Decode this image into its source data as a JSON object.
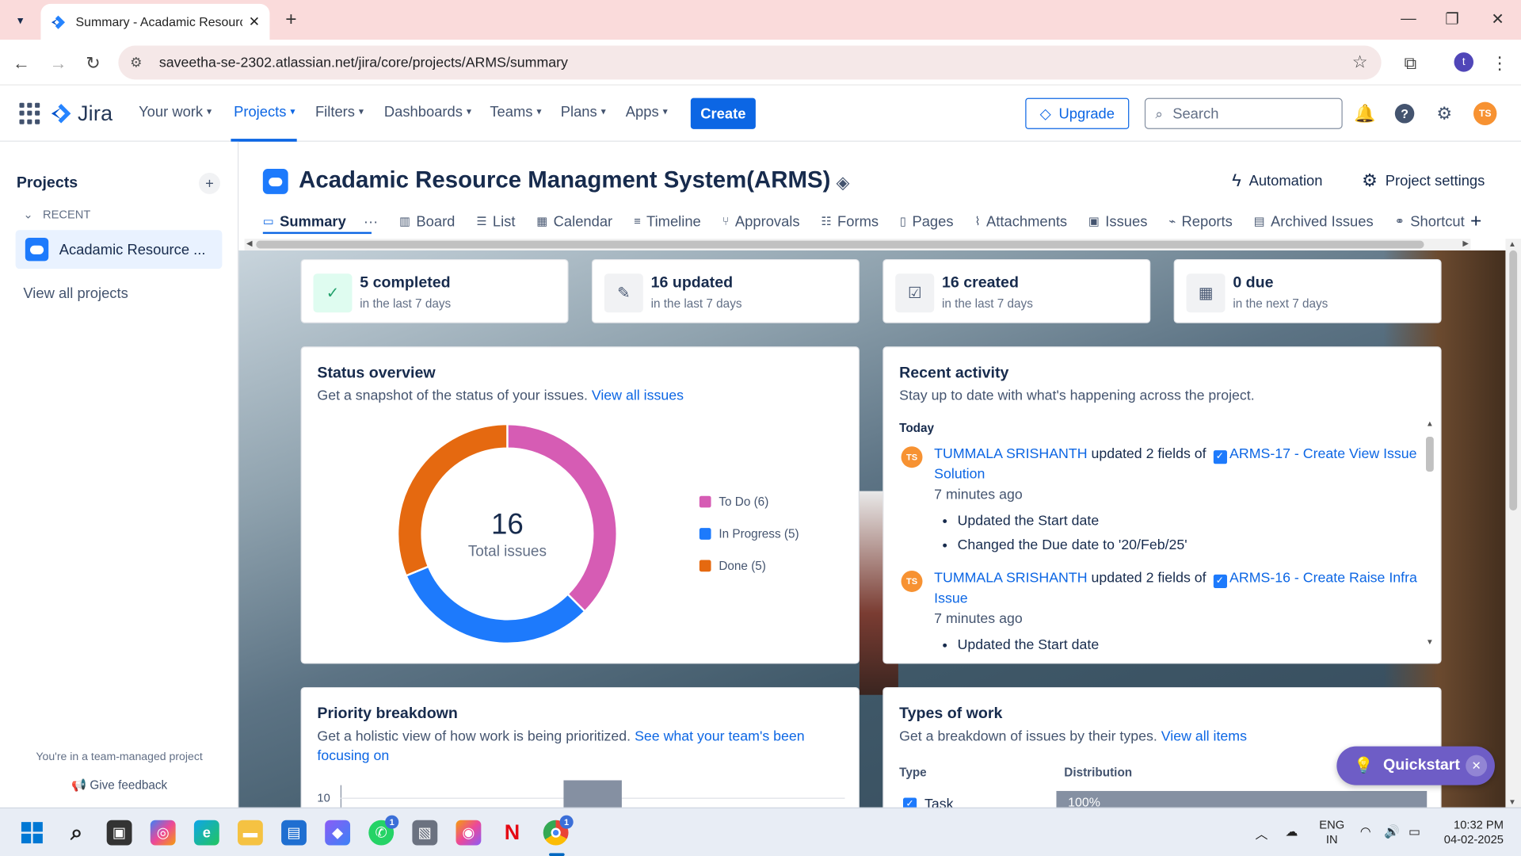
{
  "browser": {
    "tab_title": "Summary - Acadamic Resource",
    "url": "saveetha-se-2302.atlassian.net/jira/core/projects/ARMS/summary",
    "profile_initial": "t"
  },
  "topnav": {
    "logo": "Jira",
    "items": [
      "Your work",
      "Projects",
      "Filters",
      "Dashboards",
      "Teams",
      "Plans",
      "Apps"
    ],
    "create": "Create",
    "upgrade": "Upgrade",
    "search_placeholder": "Search",
    "avatar": "TS"
  },
  "sidebar": {
    "title": "Projects",
    "recent_label": "RECENT",
    "project_name": "Acadamic Resource ...",
    "view_all": "View all projects",
    "note": "You're in a team-managed project",
    "feedback": "Give feedback"
  },
  "header": {
    "title": "Acadamic Resource Managment System(ARMS)",
    "automation": "Automation",
    "settings": "Project settings",
    "tabs": [
      "Summary",
      "Board",
      "List",
      "Calendar",
      "Timeline",
      "Approvals",
      "Forms",
      "Pages",
      "Attachments",
      "Issues",
      "Reports",
      "Archived Issues",
      "Shortcut"
    ]
  },
  "stats": [
    {
      "big": "5 completed",
      "small": "in the last 7 days"
    },
    {
      "big": "16 updated",
      "small": "in the last 7 days"
    },
    {
      "big": "16 created",
      "small": "in the last 7 days"
    },
    {
      "big": "0 due",
      "small": "in the next 7 days"
    }
  ],
  "status_overview": {
    "title": "Status overview",
    "desc": "Get a snapshot of the status of your issues.",
    "link": "View all issues",
    "total": "16",
    "total_label": "Total issues",
    "legend": [
      "To Do (6)",
      "In Progress (5)",
      "Done (5)"
    ]
  },
  "chart_data": {
    "type": "pie",
    "categories": [
      "To Do",
      "In Progress",
      "Done"
    ],
    "values": [
      6,
      5,
      5
    ],
    "colors": [
      "#d65cb4",
      "#1d7afc",
      "#e56910"
    ]
  },
  "recent_activity": {
    "title": "Recent activity",
    "desc": "Stay up to date with what's happening across the project.",
    "today": "Today",
    "entries": [
      {
        "avatar": "TS",
        "user": "TUMMALA SRISHANTH",
        "action": "updated 2 fields of",
        "issue": "ARMS-17 - Create View Issue Solution",
        "time": "7 minutes ago",
        "changes": [
          "Updated the Start date",
          "Changed the Due date to '20/Feb/25'"
        ]
      },
      {
        "avatar": "TS",
        "user": "TUMMALA SRISHANTH",
        "action": "updated 2 fields of",
        "issue": "ARMS-16 - Create Raise Infra Issue",
        "time": "7 minutes ago",
        "changes": [
          "Updated the Start date"
        ]
      }
    ]
  },
  "priority": {
    "title": "Priority breakdown",
    "desc": "Get a holistic view of how work is being prioritized.",
    "link": "See what your team's been focusing on",
    "y_tick": "10"
  },
  "types_of_work": {
    "title": "Types of work",
    "desc": "Get a breakdown of issues by their types.",
    "link": "View all items",
    "col_type": "Type",
    "col_dist": "Distribution",
    "task": "Task",
    "task_pct": "100%"
  },
  "quickstart": "Quickstart",
  "taskbar": {
    "lang1": "ENG",
    "lang2": "IN",
    "time": "10:32 PM",
    "date": "04-02-2025",
    "whatsapp_badge": "1",
    "chrome_badge": "1"
  }
}
